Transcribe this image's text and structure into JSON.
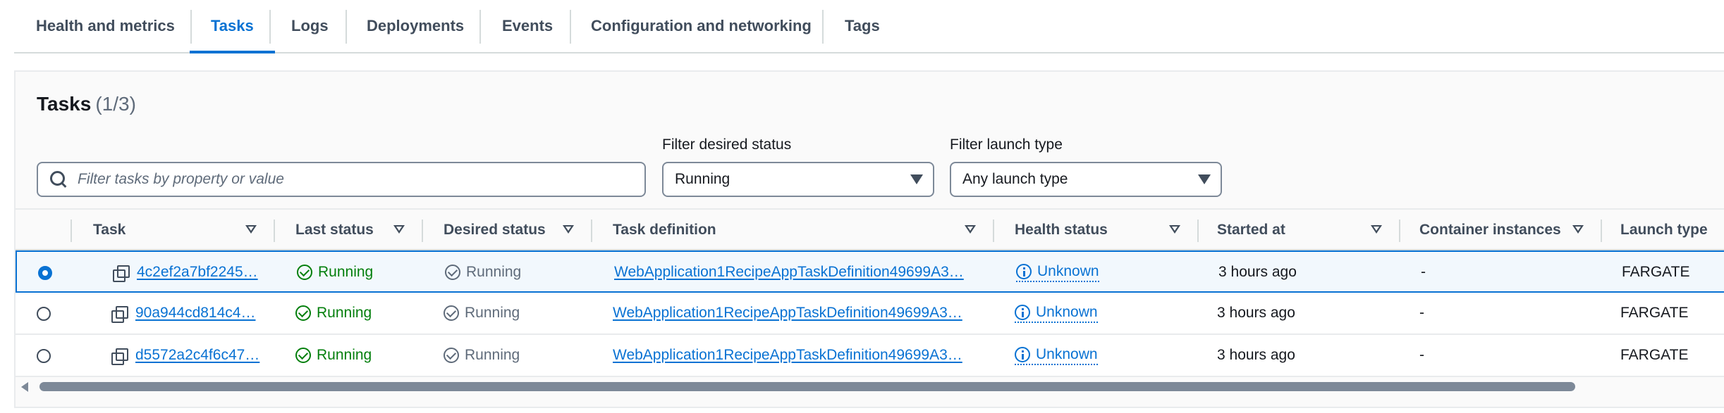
{
  "tabs": [
    {
      "label": "Health and metrics",
      "active": false
    },
    {
      "label": "Tasks",
      "active": true
    },
    {
      "label": "Logs",
      "active": false
    },
    {
      "label": "Deployments",
      "active": false
    },
    {
      "label": "Events",
      "active": false
    },
    {
      "label": "Configuration and networking",
      "active": false
    },
    {
      "label": "Tags",
      "active": false
    }
  ],
  "panel": {
    "title": "Tasks",
    "count": "(1/3)"
  },
  "search": {
    "placeholder": "Filter tasks by property or value",
    "value": ""
  },
  "filters": {
    "desired_status": {
      "label": "Filter desired status",
      "value": "Running"
    },
    "launch_type": {
      "label": "Filter launch type",
      "value": "Any launch type"
    }
  },
  "table": {
    "columns": [
      "Task",
      "Last status",
      "Desired status",
      "Task definition",
      "Health status",
      "Started at",
      "Container instances",
      "Launch type"
    ],
    "rows": [
      {
        "selected": true,
        "task": "4c2ef2a7bf2245…",
        "last_status": "Running",
        "desired_status": "Running",
        "task_definition": "WebApplication1RecipeAppTaskDefinition49699A3…",
        "health_status": "Unknown",
        "started_at": "3 hours ago",
        "container_instances": "-",
        "launch_type": "FARGATE"
      },
      {
        "selected": false,
        "task": "90a944cd814c4…",
        "last_status": "Running",
        "desired_status": "Running",
        "task_definition": "WebApplication1RecipeAppTaskDefinition49699A3…",
        "health_status": "Unknown",
        "started_at": "3 hours ago",
        "container_instances": "-",
        "launch_type": "FARGATE"
      },
      {
        "selected": false,
        "task": "d5572a2c4f6c47…",
        "last_status": "Running",
        "desired_status": "Running",
        "task_definition": "WebApplication1RecipeAppTaskDefinition49699A3…",
        "health_status": "Unknown",
        "started_at": "3 hours ago",
        "container_instances": "-",
        "launch_type": "FARGATE"
      }
    ]
  },
  "icons": {
    "search": "search-icon",
    "copy": "copy-icon",
    "status_ok": "check-circle-icon",
    "status_grey": "check-circle-icon",
    "health": "info-icon",
    "sort": "sort-down-icon",
    "dropdown": "caret-down-icon"
  },
  "colors": {
    "accent": "#0972d3",
    "success": "#037f0c",
    "muted": "#5f6b7a",
    "border": "#d5dbdb"
  }
}
